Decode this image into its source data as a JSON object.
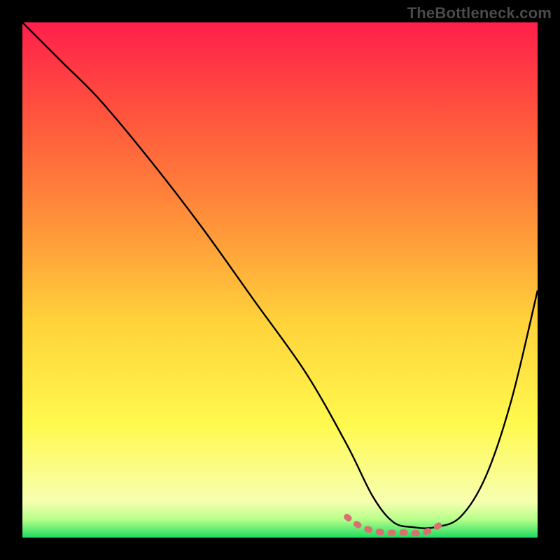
{
  "watermark": "TheBottleneck.com",
  "chart_data": {
    "type": "line",
    "title": "",
    "xlabel": "",
    "ylabel": "",
    "xlim": [
      0,
      100
    ],
    "ylim": [
      0,
      100
    ],
    "grid": false,
    "legend": false,
    "background": {
      "type": "vertical-gradient",
      "stops": [
        {
          "offset": 0.0,
          "color": "#ff1f4b"
        },
        {
          "offset": 0.2,
          "color": "#ff5a3c"
        },
        {
          "offset": 0.4,
          "color": "#ff963a"
        },
        {
          "offset": 0.58,
          "color": "#ffd23a"
        },
        {
          "offset": 0.78,
          "color": "#fff94e"
        },
        {
          "offset": 0.93,
          "color": "#f7ffb0"
        },
        {
          "offset": 0.965,
          "color": "#b6ff8a"
        },
        {
          "offset": 1.0,
          "color": "#1edc60"
        }
      ]
    },
    "series": [
      {
        "name": "bottleneck-curve",
        "color": "#000000",
        "x": [
          0,
          4,
          8,
          15,
          25,
          35,
          45,
          55,
          63,
          68,
          72,
          76,
          80,
          85,
          90,
          95,
          100
        ],
        "values": [
          100,
          96,
          92,
          85,
          73,
          60,
          46,
          32,
          18,
          8,
          3,
          2,
          2,
          4,
          12,
          27,
          48
        ]
      }
    ],
    "markers": {
      "name": "highlight-band",
      "color": "#d87070",
      "style": "thick-dashed",
      "x": [
        63,
        66,
        70,
        74,
        78,
        82
      ],
      "values": [
        4,
        2,
        1,
        1,
        1,
        3
      ]
    }
  }
}
